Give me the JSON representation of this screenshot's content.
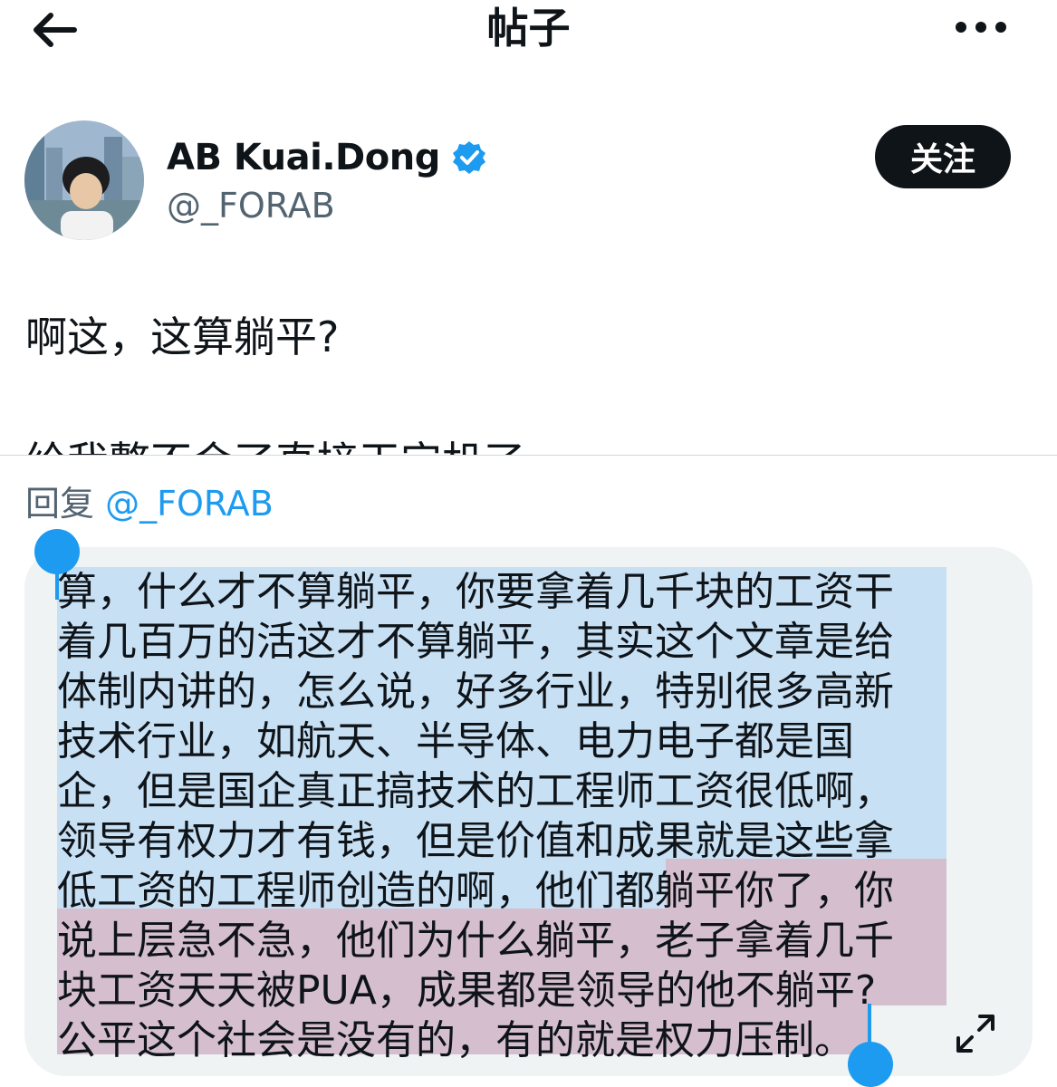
{
  "header": {
    "title": "帖子",
    "back_icon": "arrow-left-icon",
    "more_icon": "more-horizontal-icon"
  },
  "profile": {
    "name": "AB Kuai.Dong",
    "handle": "@_FORAB",
    "verified_icon": "verified-badge-icon",
    "follow_label": "关注"
  },
  "tweet": {
    "line1": "啊这，这算躺平?",
    "line2": "给我整不会了直接干宕机了"
  },
  "reply": {
    "prefix": "回复",
    "mention": "@_FORAB"
  },
  "composer": {
    "lines": [
      "算，什么才不算躺平，你要拿着几千块的工资干",
      "着几百万的活这才不算躺平，其实这个文章是给",
      "体制内讲的，怎么说，好多行业，特别很多高新",
      "技术行业，如航天、半导体、电力电子都是国",
      "企，但是国企真正搞技术的工程师工资很低啊，",
      "领导有权力才有钱，但是价值和成果就是这些拿",
      "低工资的工程师创造的啊，他们都",
      "躺平你了，你",
      "说上层急不急，他们为什么躺平，老子拿着几千",
      "块工资天天被PUA，成果都是领导的他不躺平?",
      "公平这个社会是没有的，有的就是权力压制。"
    ],
    "expand_icon": "expand-icon"
  },
  "colors": {
    "accent": "#1d9bf0",
    "selection_blue": "#c8e0f4",
    "selection_pink": "#d5bfce",
    "composer_bg": "#eff3f4",
    "follow_bg": "#0f1419"
  }
}
